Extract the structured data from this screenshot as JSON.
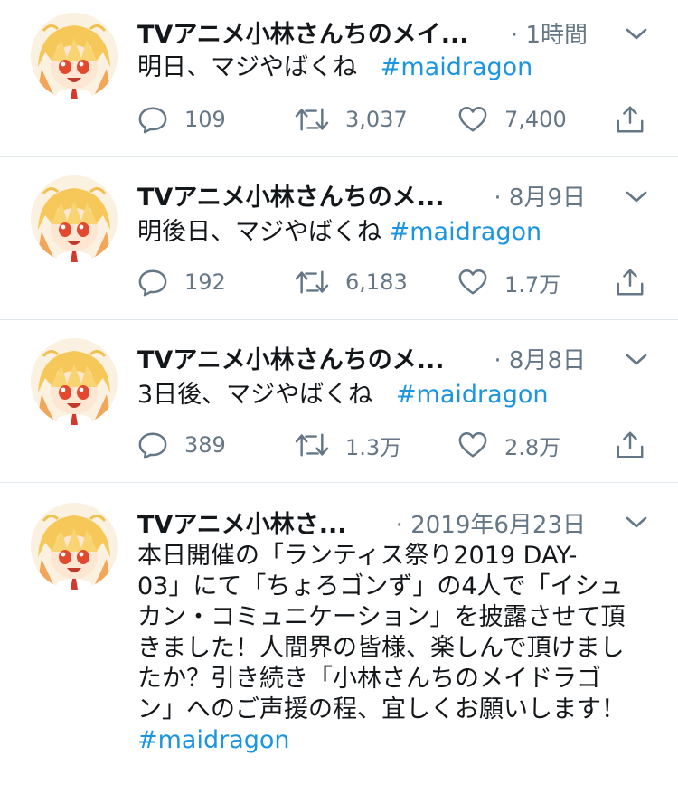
{
  "timeline": {
    "tweets": [
      {
        "name": "TVアニメ小林さんちのメイ...",
        "time": "· 1時間",
        "text": "明日、マジやばくね",
        "hashtag": "#maidragon",
        "replies": "109",
        "retweets": "3,037",
        "likes": "7,400"
      },
      {
        "name": "TVアニメ小林さんちのメ...",
        "time": "· 8月9日",
        "text": "明後日、マジやばくね",
        "hashtag": "#maidragon",
        "replies": "192",
        "retweets": "6,183",
        "likes": "1.7万"
      },
      {
        "name": "TVアニメ小林さんちのメ...",
        "time": "· 8月8日",
        "text": "3日後、マジやばくね",
        "hashtag": "#maidragon",
        "replies": "389",
        "retweets": "1.3万",
        "likes": "2.8万"
      },
      {
        "name": "TVアニメ小林さ...",
        "time": "· 2019年6月23日",
        "text": "本日開催の「ランティス祭り2019 DAY-\n03」にて「ちょろゴンず」の4人で「イシュ\nカン・コミュニケーション」を披露させて頂\nきました！人間界の皆様、楽しんで頂けまし\nたか？引き続き「小林さんちのメイドラゴ\nン」へのご声援の程、宜しくお願いします！",
        "hashtag": "#maidragon"
      }
    ]
  },
  "colors": {
    "hashtag": "#1b95e0",
    "secondary_text": "#657786",
    "divider": "#e1e8ed",
    "primary_text": "#14171a"
  },
  "icons": [
    "avatar",
    "chevron-down-icon",
    "reply-icon",
    "retweet-icon",
    "like-icon",
    "share-icon"
  ]
}
